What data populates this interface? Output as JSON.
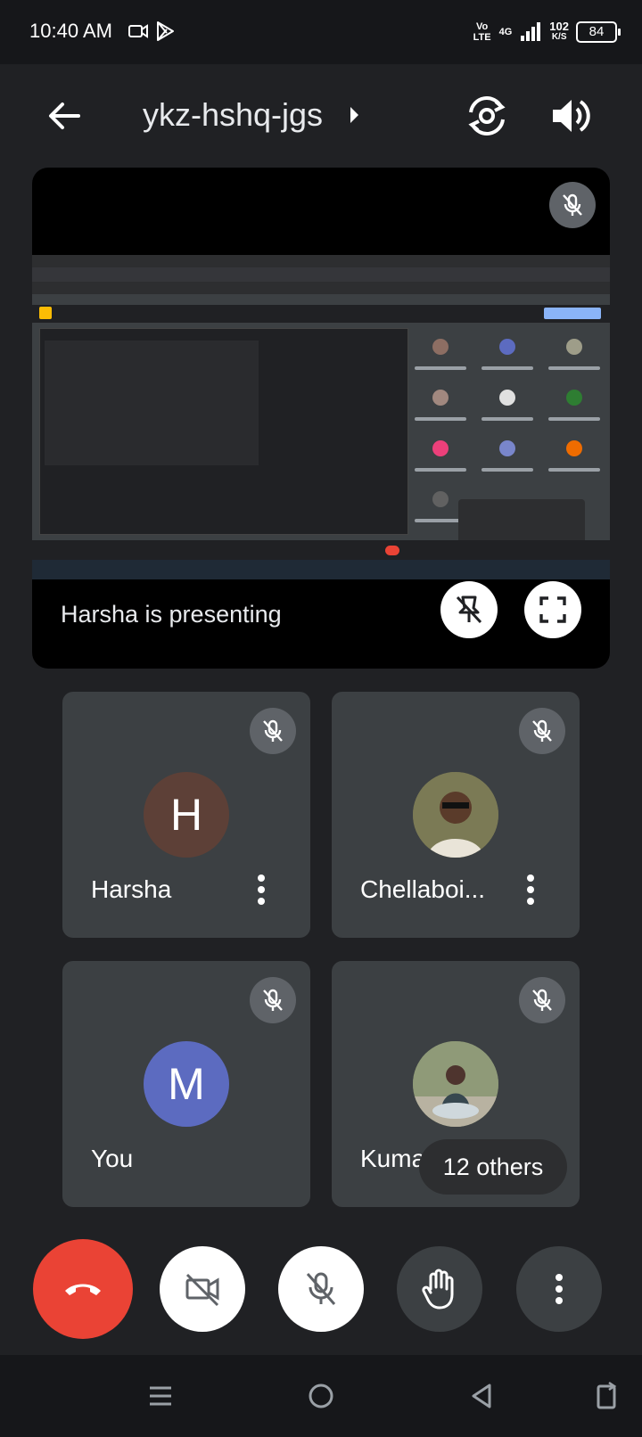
{
  "status_bar": {
    "time": "10:40 AM",
    "network": "Vo LTE",
    "signal": "4G",
    "speed_value": "102",
    "speed_unit": "K/S",
    "battery": "84"
  },
  "top_bar": {
    "meeting_code": "ykz-hshq-jgs"
  },
  "presentation": {
    "label": "Harsha is presenting"
  },
  "participants": [
    {
      "name": "Harsha",
      "initial": "H",
      "avatar_color": "#5d4037"
    },
    {
      "name": "Chellaboi...",
      "initial": "",
      "avatar_color": "#6d6a4e"
    },
    {
      "name": "You",
      "initial": "M",
      "avatar_color": "#5c6bc0"
    },
    {
      "name": "Kumar",
      "initial": "",
      "avatar_color": "#7a8466"
    }
  ],
  "others_pill": "12 others",
  "colors": {
    "background": "#202124",
    "tile": "#3c4043",
    "hangup": "#ea4335",
    "mute_badge": "#5f6368"
  },
  "icons": [
    "back-arrow-icon",
    "play-arrow-icon",
    "switch-camera-icon",
    "speaker-icon",
    "mic-off-icon",
    "pin-off-icon",
    "fullscreen-icon",
    "more-vert-icon",
    "hang-up-icon",
    "camera-off-icon",
    "raise-hand-icon",
    "menu-icon",
    "home-icon",
    "back-icon",
    "rotate-icon"
  ]
}
